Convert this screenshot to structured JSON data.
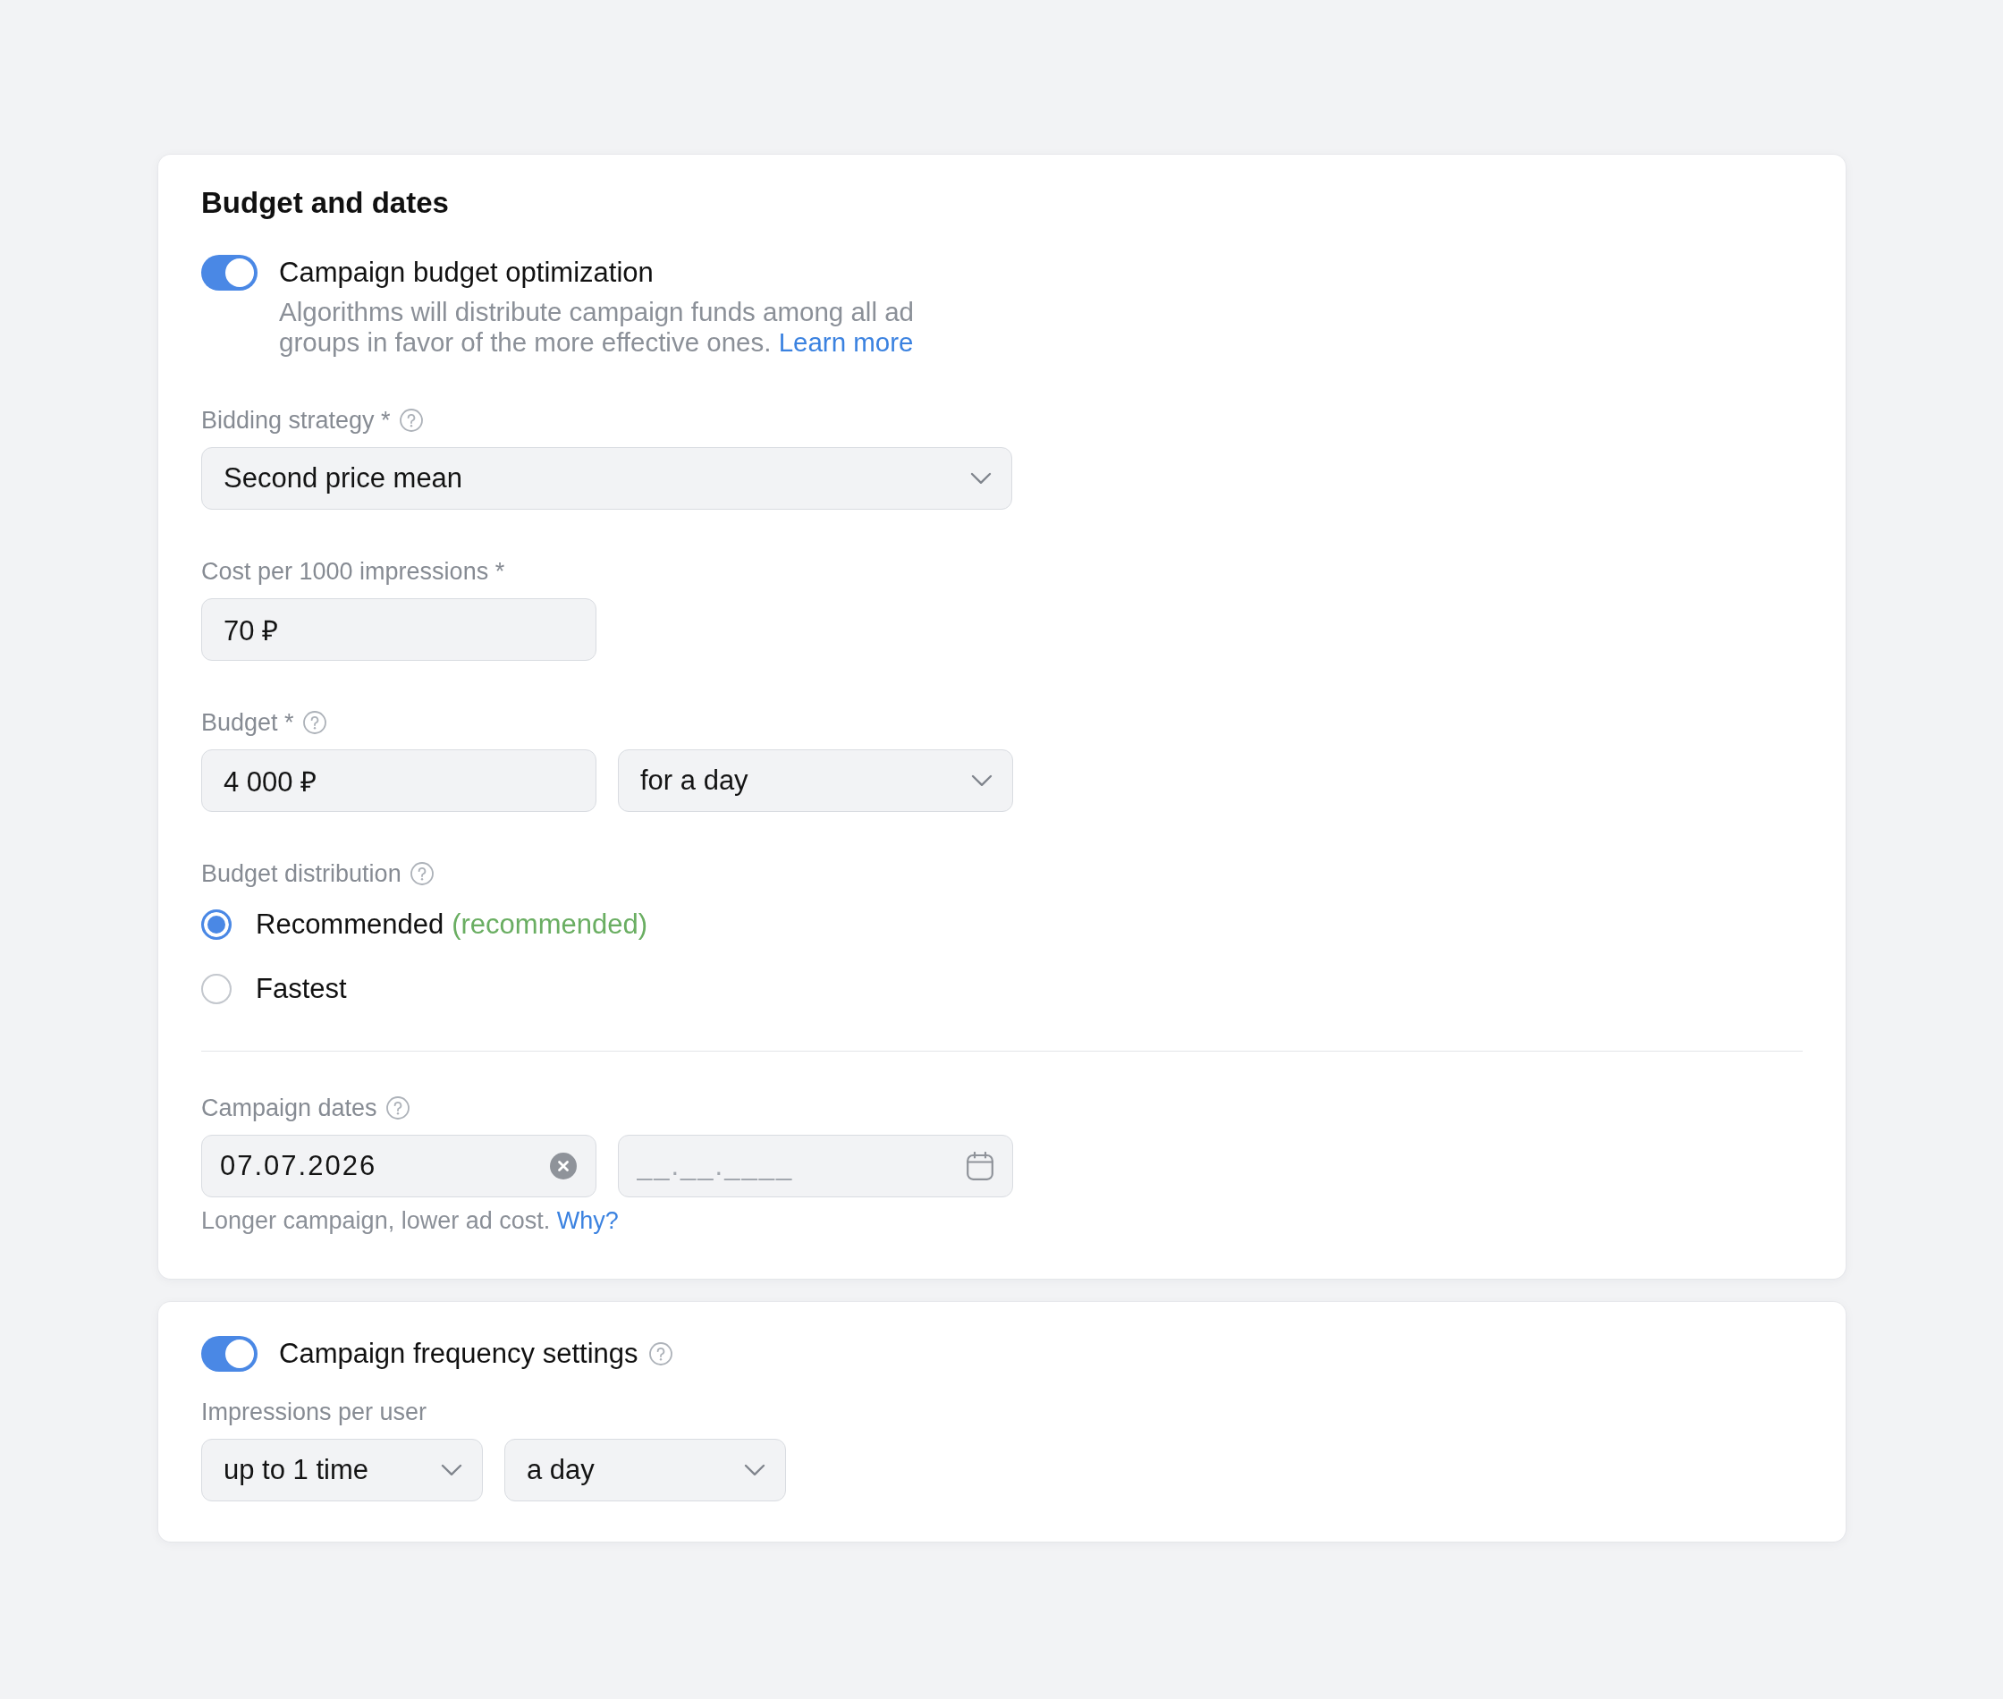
{
  "budget_card": {
    "title": "Budget and dates",
    "optimization": {
      "label": "Campaign budget optimization",
      "on": true,
      "description": "Algorithms will distribute campaign funds among all ad groups in favor of the more effective ones.",
      "link": "Learn more"
    },
    "fields": [
      {
        "kind": "controls",
        "label": "Bidding strategy *",
        "help": true,
        "controls": [
          {
            "kind": "select",
            "value": "Second price mean"
          }
        ]
      },
      {
        "kind": "controls",
        "label": "Cost per 1000 impressions *",
        "controls": [
          {
            "kind": "input",
            "value": "70 ₽"
          }
        ]
      },
      {
        "kind": "controls",
        "label": "Budget *",
        "help": true,
        "controls": [
          {
            "kind": "input",
            "value": "4 000 ₽"
          },
          {
            "kind": "select",
            "value": "for a day"
          }
        ]
      },
      {
        "kind": "radios",
        "label": "Budget distribution",
        "help": true,
        "options": [
          {
            "label": "Recommended",
            "note": "(recommended)",
            "selected": true
          },
          {
            "label": "Fastest",
            "selected": false
          }
        ]
      },
      {
        "kind": "divider"
      },
      {
        "kind": "controls",
        "label": "Campaign dates",
        "help": true,
        "controls": [
          {
            "kind": "date",
            "value": "07.07.2026",
            "clearable": true
          },
          {
            "kind": "date",
            "placeholder": "__.__.____",
            "clearable": false
          }
        ],
        "hint": "Longer campaign, lower ad cost.",
        "hint_link": "Why?"
      }
    ]
  },
  "frequency_card": {
    "toggle": {
      "label": "Campaign frequency settings",
      "on": true,
      "help": true
    },
    "fields": [
      {
        "kind": "controls",
        "label": "Impressions per user",
        "controls": [
          {
            "kind": "select",
            "value": "up to 1 time"
          },
          {
            "kind": "select",
            "value": "a day"
          }
        ]
      }
    ]
  }
}
